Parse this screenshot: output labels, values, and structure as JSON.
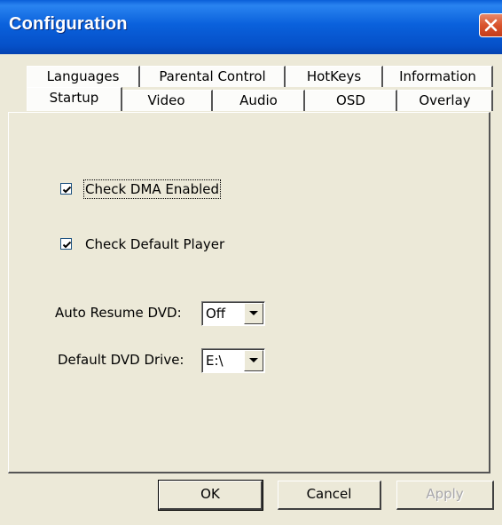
{
  "window": {
    "title": "Configuration"
  },
  "tabs": {
    "row_back": [
      {
        "label": "Languages"
      },
      {
        "label": "Parental Control"
      },
      {
        "label": "HotKeys"
      },
      {
        "label": "Information"
      }
    ],
    "row_front": [
      {
        "label": "Startup",
        "selected": true
      },
      {
        "label": "Video"
      },
      {
        "label": "Audio"
      },
      {
        "label": "OSD"
      },
      {
        "label": "Overlay"
      }
    ]
  },
  "startup": {
    "check_dma": {
      "label": "Check DMA Enabled",
      "checked": true
    },
    "check_default_player": {
      "label": "Check Default Player",
      "checked": true
    },
    "auto_resume": {
      "label": "Auto Resume DVD:",
      "value": "Off"
    },
    "default_drive": {
      "label": "Default DVD Drive:",
      "value": "E:\\"
    }
  },
  "buttons": {
    "ok": "OK",
    "cancel": "Cancel",
    "apply": "Apply"
  },
  "colors": {
    "titlebar": "#0a5fd8",
    "face": "#ece9d8",
    "close": "#d9532c"
  }
}
